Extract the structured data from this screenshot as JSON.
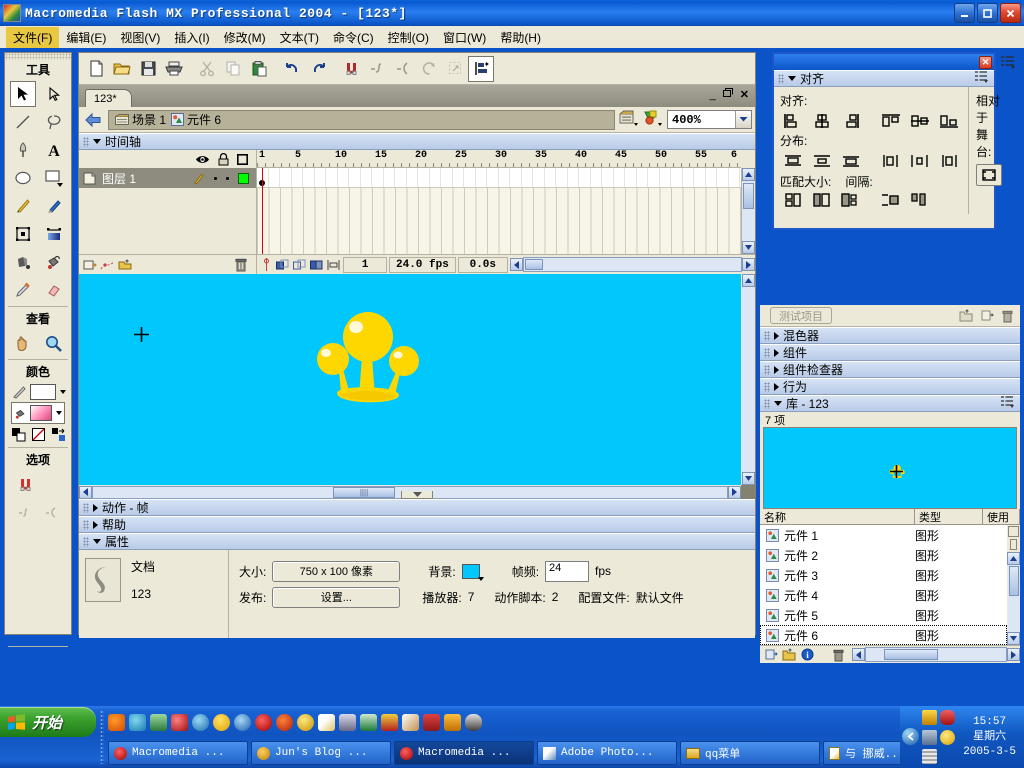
{
  "window": {
    "title": "Macromedia Flash MX Professional 2004 - [123*]",
    "app_icon": "flash-logo-icon",
    "minimize": "_",
    "maximize": "❐",
    "close": "✕"
  },
  "menubar": {
    "items": [
      {
        "label": "文件(F)",
        "name": "menu-file",
        "highlight": true
      },
      {
        "label": "编辑(E)",
        "name": "menu-edit",
        "highlight": false
      },
      {
        "label": "视图(V)",
        "name": "menu-view",
        "highlight": false
      },
      {
        "label": "插入(I)",
        "name": "menu-insert",
        "highlight": false
      },
      {
        "label": "修改(M)",
        "name": "menu-modify",
        "highlight": false
      },
      {
        "label": "文本(T)",
        "name": "menu-text",
        "highlight": false
      },
      {
        "label": "命令(C)",
        "name": "menu-command",
        "highlight": false
      },
      {
        "label": "控制(O)",
        "name": "menu-control",
        "highlight": false
      },
      {
        "label": "窗口(W)",
        "name": "menu-window",
        "highlight": false
      },
      {
        "label": "帮助(H)",
        "name": "menu-help",
        "highlight": false
      }
    ]
  },
  "tools_panel": {
    "tools_label": "工具",
    "view_label": "查看",
    "colors_label": "颜色",
    "options_label": "选项",
    "tools": [
      "arrow-select-icon",
      "subselect-arrow-icon",
      "line-icon",
      "lasso-icon",
      "pen-icon",
      "text-A-icon",
      "oval-icon",
      "rectangle-icon",
      "pencil-icon",
      "brush-icon",
      "free-transform-icon",
      "fill-transform-icon",
      "ink-bottle-icon",
      "paint-bucket-icon",
      "eyedropper-icon",
      "eraser-icon"
    ],
    "view_tools": [
      "hand-icon",
      "zoom-magnifier-icon"
    ],
    "color_stroke_icon": "pencil-stroke-icon",
    "color_fill_icon": "paint-bucket-fill-icon",
    "color_extra": [
      "black-white-icon",
      "no-color-icon",
      "swap-colors-icon"
    ],
    "option_tools": [
      "magnet-snap-icon",
      "smooth-icon",
      "straighten-icon"
    ]
  },
  "main_toolbar": {
    "buttons": [
      "new-document-icon",
      "open-folder-icon",
      "save-icon",
      "print-icon",
      "cut-scissors-icon",
      "copy-icon",
      "paste-icon",
      "undo-arrow-icon",
      "redo-arrow-icon",
      "magnet-snap-icon",
      "smooth-curve-icon",
      "straighten-curve-icon",
      "rotate-icon",
      "scale-icon",
      "align-icon"
    ]
  },
  "document": {
    "tab_label": "123*",
    "tab_buttons": {
      "minimize": "_",
      "restore": "❐",
      "close": "✕"
    },
    "breadcrumb": {
      "back_icon": "back-arrow-icon",
      "items": [
        {
          "icon": "scene-icon",
          "label": "场景 1"
        },
        {
          "icon": "symbol-graphic-icon",
          "label": "元件 6"
        }
      ],
      "edit_scene_icon": "edit-scene-icon",
      "edit_symbols_icon": "edit-symbols-icon"
    },
    "zoom": "400%"
  },
  "timeline": {
    "panel_label": "时间轴",
    "header_icons": [
      "eye-icon",
      "lock-icon",
      "outline-square-icon"
    ],
    "ruler_ticks": [
      "1",
      "5",
      "10",
      "15",
      "20",
      "25",
      "30",
      "35",
      "40",
      "45",
      "50",
      "55",
      "6"
    ],
    "layers": [
      {
        "name": "图层 1",
        "icon": "layer-page-icon",
        "pencil": "pencil-edit-icon",
        "color": "#00ff00"
      }
    ],
    "layer_tools": [
      "insert-layer-icon",
      "add-motion-guide-icon",
      "insert-folder-icon",
      "delete-layer-trash-icon"
    ],
    "controls": [
      "center-frame-icon",
      "onion-skin-icon",
      "onion-skin-outlines-icon",
      "edit-multiple-frames-icon",
      "modify-onion-markers-icon"
    ],
    "current_frame": "1",
    "fps": "24.0 fps",
    "elapsed": "0.0s"
  },
  "stage": {
    "background_color": "#00c8fc",
    "artwork_name": "yellow-crown-graphic",
    "crown_color": "#ffe000",
    "crown_shade": "#f5c000",
    "registration_mark": "+"
  },
  "bottom_panels": {
    "actions_label": "动作 - 帧",
    "help_label": "帮助",
    "properties_label": "属性"
  },
  "properties": {
    "doc_icon": "flash-document-icon",
    "type_label": "文档",
    "doc_name": "123",
    "size_label": "大小:",
    "size_value": "750 x 100 像素",
    "background_label": "背景:",
    "background_color": "#00c8fc",
    "fps_label": "帧频:",
    "fps_value": "24",
    "fps_unit": "fps",
    "publish_label": "发布:",
    "publish_button": "设置...",
    "player_label": "播放器:",
    "player_value": "7",
    "actionscript_label": "动作脚本:",
    "actionscript_value": "2",
    "profile_label": "配置文件:",
    "profile_value": "默认文件"
  },
  "align_panel": {
    "title": "对齐",
    "close": "✕",
    "options_icon": "panel-options-icon",
    "align_label": "对齐:",
    "distribute_label": "分布:",
    "match_size_label": "匹配大小:",
    "space_label": "间隔:",
    "relative_label": "相对于\n舞台:",
    "relative_label_1": "相对于",
    "relative_label_2": "舞台:",
    "align_buttons": [
      "align-left-icon",
      "align-horizontal-center-icon",
      "align-right-icon",
      "align-top-icon",
      "align-vertical-center-icon",
      "align-bottom-icon"
    ],
    "distribute_buttons": [
      "distribute-top-icon",
      "distribute-vertical-center-icon",
      "distribute-bottom-icon",
      "distribute-left-icon",
      "distribute-horizontal-center-icon",
      "distribute-right-icon"
    ],
    "match_buttons": [
      "match-width-icon",
      "match-height-icon",
      "match-width-height-icon"
    ],
    "space_buttons": [
      "space-evenly-vertical-icon",
      "space-evenly-horizontal-icon"
    ],
    "stage_toggle_icon": "to-stage-icon"
  },
  "right_panels": {
    "test_project_button": "测试项目",
    "test_row_icons": [
      "new-project-folder-icon",
      "add-file-icon",
      "delete-trash-icon"
    ],
    "collapsed": [
      {
        "label": "混色器",
        "name": "panel-color-mixer"
      },
      {
        "label": "组件",
        "name": "panel-components"
      },
      {
        "label": "组件检查器",
        "name": "panel-component-inspector"
      },
      {
        "label": "行为",
        "name": "panel-behaviors"
      }
    ],
    "library": {
      "label": "库 - 123",
      "options_icon": "panel-options-icon",
      "count": "7 项",
      "preview_bg": "#00c8fc",
      "columns": [
        "名称",
        "类型",
        "使用"
      ],
      "items": [
        {
          "name": "元件 1",
          "type": "图形",
          "selected": false
        },
        {
          "name": "元件 2",
          "type": "图形",
          "selected": false
        },
        {
          "name": "元件 3",
          "type": "图形",
          "selected": false
        },
        {
          "name": "元件 4",
          "type": "图形",
          "selected": false
        },
        {
          "name": "元件 5",
          "type": "图形",
          "selected": false
        },
        {
          "name": "元件 6",
          "type": "图形",
          "selected": true
        }
      ],
      "footer_icons": [
        "new-symbol-icon",
        "new-folder-icon",
        "symbol-properties-icon",
        "delete-trash-icon"
      ]
    }
  },
  "taskbar": {
    "start_label": "开始",
    "start_icon": "windows-flag-icon",
    "quick_launch": [
      "media-player-icon",
      "chat-icon",
      "outlook-express-icon",
      "paint-blob-icon",
      "maxthon-icon",
      "emoticon-icon",
      "internet-explorer-icon",
      "flash-icon",
      "fireworks-icon",
      "settings-gear-icon",
      "notepad-edit-icon",
      "winzip-icon",
      "excel-icon",
      "list-icon",
      "search-dog-icon",
      "person-red-icon",
      "lock-orange-icon",
      "qq-penguin-icon"
    ],
    "buttons": [
      {
        "label": "Macromedia ...",
        "icon": "flash-icon",
        "active": false
      },
      {
        "label": "Jun's Blog ...",
        "icon": "maxthon-icon",
        "active": false
      },
      {
        "label": "Macromedia ...",
        "icon": "flash-icon",
        "active": true
      },
      {
        "label": "Adobe Photo...",
        "icon": "photoshop-icon",
        "active": false
      },
      {
        "label": "qq菜单",
        "icon": "folder-icon",
        "active": false
      },
      {
        "label": "与        挪威...",
        "icon": "notepad-icon",
        "active": false
      }
    ],
    "tray": {
      "show_hidden_icon": "chevron-left-icon",
      "icons": [
        "qq-penguin-yellow-icon",
        "qq-penguin-santa-icon",
        "person-blue-icon",
        "emoticon-yellow-icon",
        "firewall-icon"
      ],
      "time": "15:57",
      "weekday": "星期六",
      "date": "2005-3-5"
    }
  }
}
